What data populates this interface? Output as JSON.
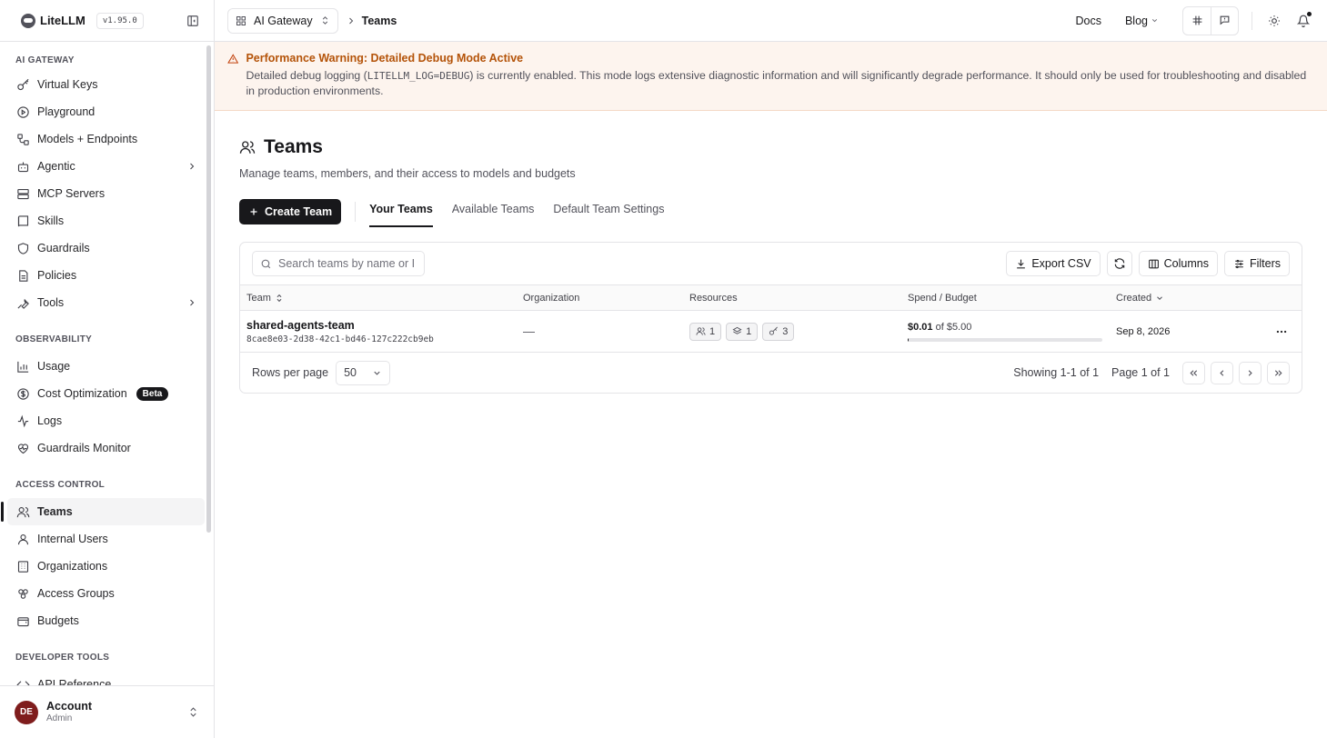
{
  "app": {
    "name": "LiteLLM",
    "version": "v1.95.0"
  },
  "sidebar": {
    "sections": [
      {
        "title": "AI GATEWAY",
        "items": [
          {
            "label": "Virtual Keys"
          },
          {
            "label": "Playground"
          },
          {
            "label": "Models + Endpoints"
          },
          {
            "label": "Agentic"
          },
          {
            "label": "MCP Servers"
          },
          {
            "label": "Skills"
          },
          {
            "label": "Guardrails"
          },
          {
            "label": "Policies"
          },
          {
            "label": "Tools"
          }
        ]
      },
      {
        "title": "OBSERVABILITY",
        "items": [
          {
            "label": "Usage"
          },
          {
            "label": "Cost Optimization",
            "badge": "Beta"
          },
          {
            "label": "Logs"
          },
          {
            "label": "Guardrails Monitor"
          }
        ]
      },
      {
        "title": "ACCESS CONTROL",
        "items": [
          {
            "label": "Teams"
          },
          {
            "label": "Internal Users"
          },
          {
            "label": "Organizations"
          },
          {
            "label": "Access Groups"
          },
          {
            "label": "Budgets"
          }
        ]
      },
      {
        "title": "DEVELOPER TOOLS",
        "items": [
          {
            "label": "API Reference"
          }
        ]
      }
    ],
    "account": {
      "initials": "DE",
      "name": "Account",
      "role": "Admin"
    }
  },
  "topbar": {
    "workspace": "AI Gateway",
    "breadcrumb": "Teams",
    "links": {
      "docs": "Docs",
      "blog": "Blog"
    }
  },
  "warning": {
    "title": "Performance Warning: Detailed Debug Mode Active",
    "body_prefix": "Detailed debug logging (",
    "body_code": "LITELLM_LOG=DEBUG",
    "body_suffix": ") is currently enabled. This mode logs extensive diagnostic information and will significantly degrade performance. It should only be used for troubleshooting and disabled in production environments."
  },
  "page": {
    "title": "Teams",
    "subtitle": "Manage teams, members, and their access to models and budgets",
    "create_button": "Create Team",
    "tabs": [
      {
        "label": "Your Teams"
      },
      {
        "label": "Available Teams"
      },
      {
        "label": "Default Team Settings"
      }
    ]
  },
  "table": {
    "search_placeholder": "Search teams by name or ID...",
    "buttons": {
      "export": "Export CSV",
      "columns": "Columns",
      "filters": "Filters"
    },
    "headers": [
      "Team",
      "Organization",
      "Resources",
      "Spend / Budget",
      "Created"
    ],
    "rows": [
      {
        "name": "shared-agents-team",
        "id": "8cae8e03-2d38-42c1-bd46-127c222cb9eb",
        "organization": "—",
        "resources": {
          "members": "1",
          "models": "1",
          "keys": "3"
        },
        "spend": "$0.01",
        "budget_text": "of $5.00",
        "spend_fraction": 0.002,
        "created": "Sep 8, 2026"
      }
    ],
    "footer": {
      "rows_label": "Rows per page",
      "rows_value": "50",
      "showing": "Showing 1-1 of 1",
      "page": "Page 1 of 1"
    }
  }
}
